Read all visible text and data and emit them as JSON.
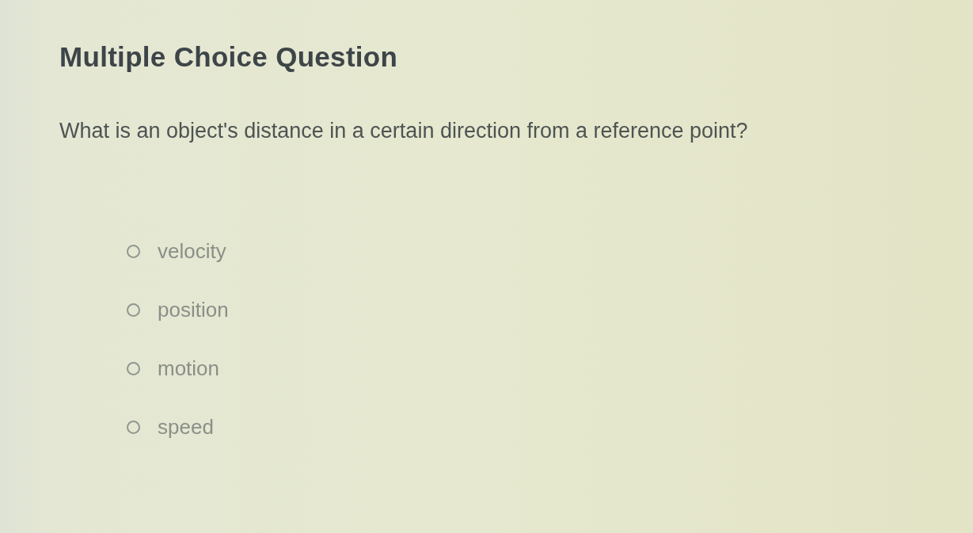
{
  "title": "Multiple Choice Question",
  "question": "What is an object's distance in a certain direction from a reference point?",
  "options": [
    {
      "label": "velocity",
      "selected": false
    },
    {
      "label": "position",
      "selected": false
    },
    {
      "label": "motion",
      "selected": false
    },
    {
      "label": "speed",
      "selected": false
    }
  ]
}
